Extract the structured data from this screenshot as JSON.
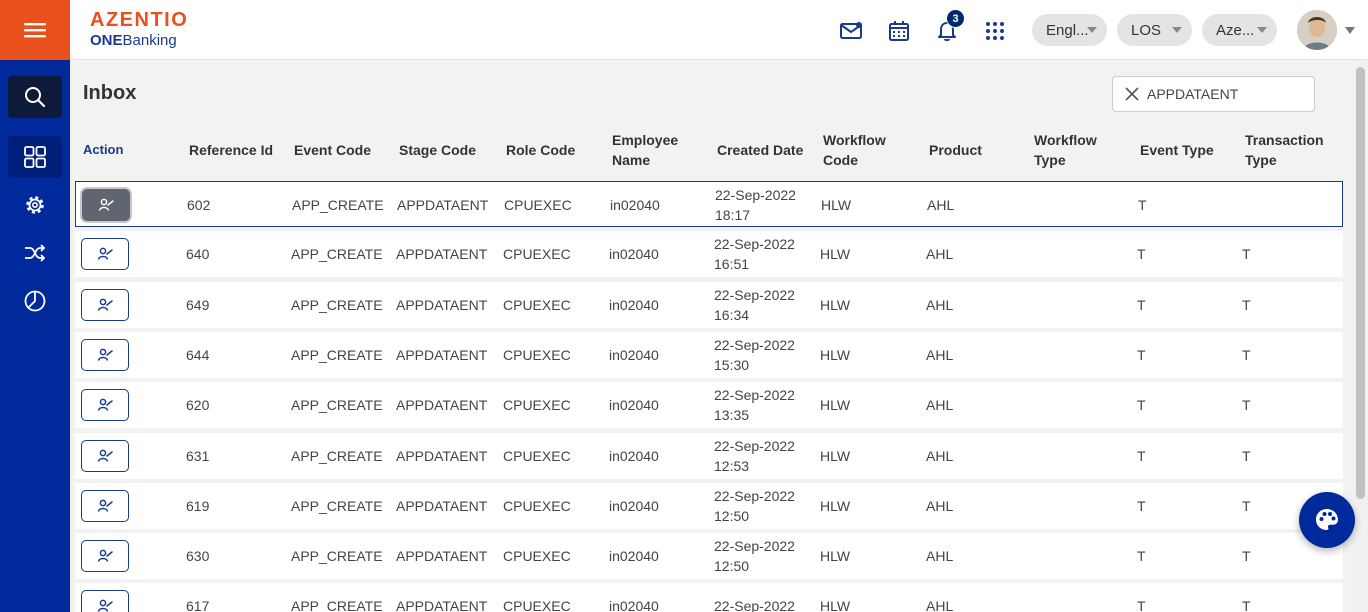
{
  "brand": {
    "name": "AZENTIO",
    "sub_bold": "ONE",
    "sub_rest": "Banking"
  },
  "header": {
    "notification_count": "3",
    "language": "Engl...",
    "module": "LOS",
    "entity": "Aze..."
  },
  "page": {
    "title": "Inbox"
  },
  "search": {
    "value": "APPDATAENT"
  },
  "table": {
    "columns": [
      {
        "key": "action",
        "label": "Action"
      },
      {
        "key": "ref",
        "label": "Reference Id"
      },
      {
        "key": "event",
        "label": "Event Code"
      },
      {
        "key": "stage",
        "label": "Stage Code"
      },
      {
        "key": "role",
        "label": "Role Code"
      },
      {
        "key": "emp",
        "label": "Employee Name"
      },
      {
        "key": "created",
        "label": "Created Date"
      },
      {
        "key": "wfcode",
        "label": "Workflow Code"
      },
      {
        "key": "product",
        "label": "Product"
      },
      {
        "key": "wftype",
        "label": "Workflow Type"
      },
      {
        "key": "evtype",
        "label": "Event Type"
      },
      {
        "key": "txtype",
        "label": "Transaction Type"
      }
    ],
    "rows": [
      {
        "ref": "602",
        "event": "APP_CREATE",
        "stage": "APPDATAENT",
        "role": "CPUEXEC",
        "emp": "in02040",
        "created": "22-Sep-2022 18:17",
        "wfcode": "HLW",
        "product": "AHL",
        "wftype": "",
        "evtype": "T",
        "txtype": ""
      },
      {
        "ref": "640",
        "event": "APP_CREATE",
        "stage": "APPDATAENT",
        "role": "CPUEXEC",
        "emp": "in02040",
        "created": "22-Sep-2022 16:51",
        "wfcode": "HLW",
        "product": "AHL",
        "wftype": "",
        "evtype": "T",
        "txtype": "T"
      },
      {
        "ref": "649",
        "event": "APP_CREATE",
        "stage": "APPDATAENT",
        "role": "CPUEXEC",
        "emp": "in02040",
        "created": "22-Sep-2022 16:34",
        "wfcode": "HLW",
        "product": "AHL",
        "wftype": "",
        "evtype": "T",
        "txtype": "T"
      },
      {
        "ref": "644",
        "event": "APP_CREATE",
        "stage": "APPDATAENT",
        "role": "CPUEXEC",
        "emp": "in02040",
        "created": "22-Sep-2022 15:30",
        "wfcode": "HLW",
        "product": "AHL",
        "wftype": "",
        "evtype": "T",
        "txtype": "T"
      },
      {
        "ref": "620",
        "event": "APP_CREATE",
        "stage": "APPDATAENT",
        "role": "CPUEXEC",
        "emp": "in02040",
        "created": "22-Sep-2022 13:35",
        "wfcode": "HLW",
        "product": "AHL",
        "wftype": "",
        "evtype": "T",
        "txtype": "T"
      },
      {
        "ref": "631",
        "event": "APP_CREATE",
        "stage": "APPDATAENT",
        "role": "CPUEXEC",
        "emp": "in02040",
        "created": "22-Sep-2022 12:53",
        "wfcode": "HLW",
        "product": "AHL",
        "wftype": "",
        "evtype": "T",
        "txtype": "T"
      },
      {
        "ref": "619",
        "event": "APP_CREATE",
        "stage": "APPDATAENT",
        "role": "CPUEXEC",
        "emp": "in02040",
        "created": "22-Sep-2022 12:50",
        "wfcode": "HLW",
        "product": "AHL",
        "wftype": "",
        "evtype": "T",
        "txtype": "T"
      },
      {
        "ref": "630",
        "event": "APP_CREATE",
        "stage": "APPDATAENT",
        "role": "CPUEXEC",
        "emp": "in02040",
        "created": "22-Sep-2022 12:50",
        "wfcode": "HLW",
        "product": "AHL",
        "wftype": "",
        "evtype": "T",
        "txtype": "T"
      },
      {
        "ref": "617",
        "event": "APP_CREATE",
        "stage": "APPDATAENT",
        "role": "CPUEXEC",
        "emp": "in02040",
        "created": "22-Sep-2022",
        "wfcode": "HLW",
        "product": "AHL",
        "wftype": "",
        "evtype": "T",
        "txtype": "T"
      }
    ]
  },
  "colors": {
    "brand_orange": "#e8501c",
    "brand_navy": "#002a9b",
    "accent_dark": "#1a3a8f"
  }
}
